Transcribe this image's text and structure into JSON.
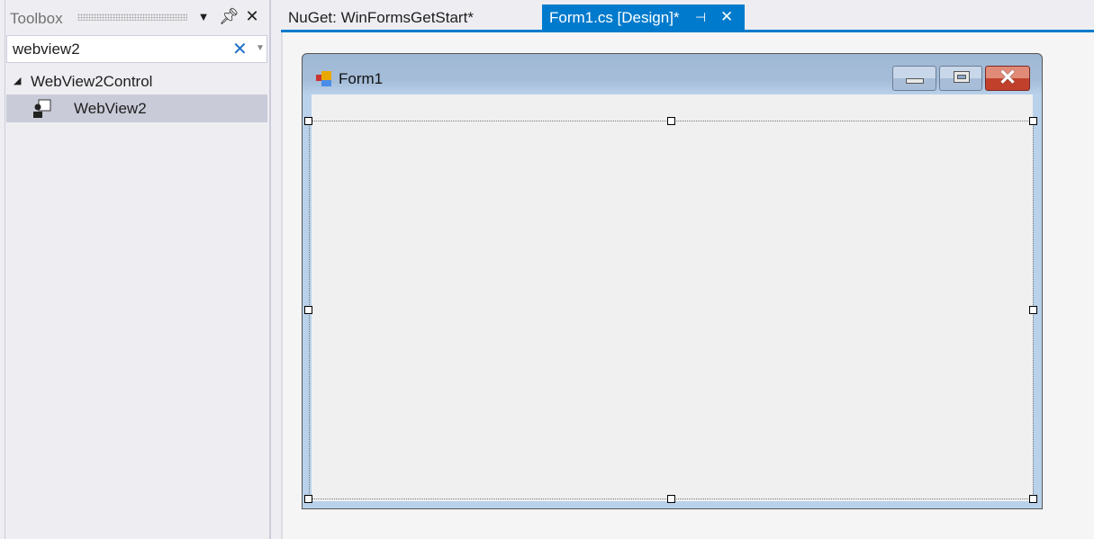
{
  "toolbox": {
    "title": "Toolbox",
    "search_value": "webview2",
    "category": "WebView2Control",
    "items": [
      {
        "label": "WebView2",
        "selected": true
      }
    ]
  },
  "tabs": [
    {
      "label": "NuGet: WinFormsGetStart*",
      "active": false
    },
    {
      "label": "Form1.cs [Design]*",
      "active": true
    }
  ],
  "form": {
    "title": "Form1"
  },
  "colors": {
    "accent": "#007acc",
    "selected_item": "#c9cbd8",
    "close_button": "#c0402c"
  }
}
